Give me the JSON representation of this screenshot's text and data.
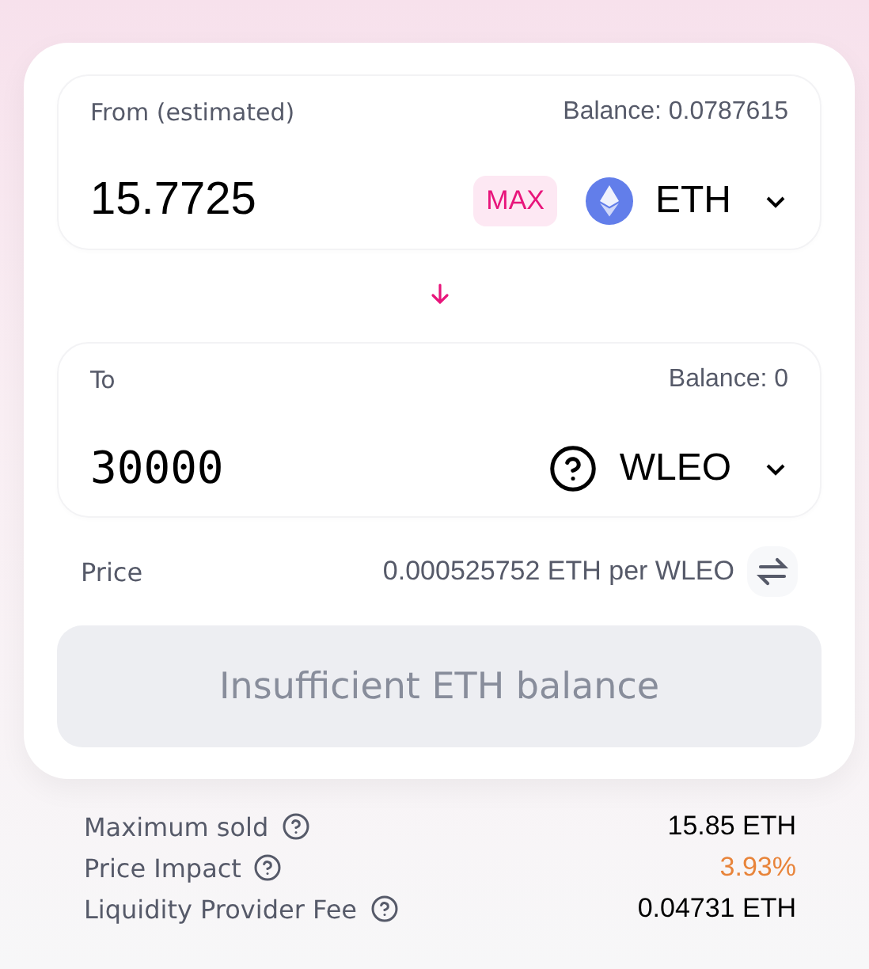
{
  "from": {
    "label": "From (estimated)",
    "balance": "Balance: 0.0787615",
    "value": "15.7725",
    "max": "MAX",
    "token": {
      "symbol": "ETH",
      "kind": "eth"
    }
  },
  "to": {
    "label": "To",
    "balance": "Balance: 0",
    "value": "30000",
    "token": {
      "symbol": "WLEO",
      "kind": "unknown"
    }
  },
  "price": {
    "label": "Price",
    "value": "0.000525752 ETH per WLEO"
  },
  "swap_button": {
    "label": "Insufficient ETH balance",
    "disabled": true
  },
  "details": [
    {
      "label": "Maximum sold",
      "value": "15.85 ETH",
      "color": "#000000"
    },
    {
      "label": "Price Impact",
      "value": "3.93%",
      "color": "#e8843a"
    },
    {
      "label": "Liquidity Provider Fee",
      "value": "0.04731 ETH",
      "color": "#000000"
    }
  ]
}
